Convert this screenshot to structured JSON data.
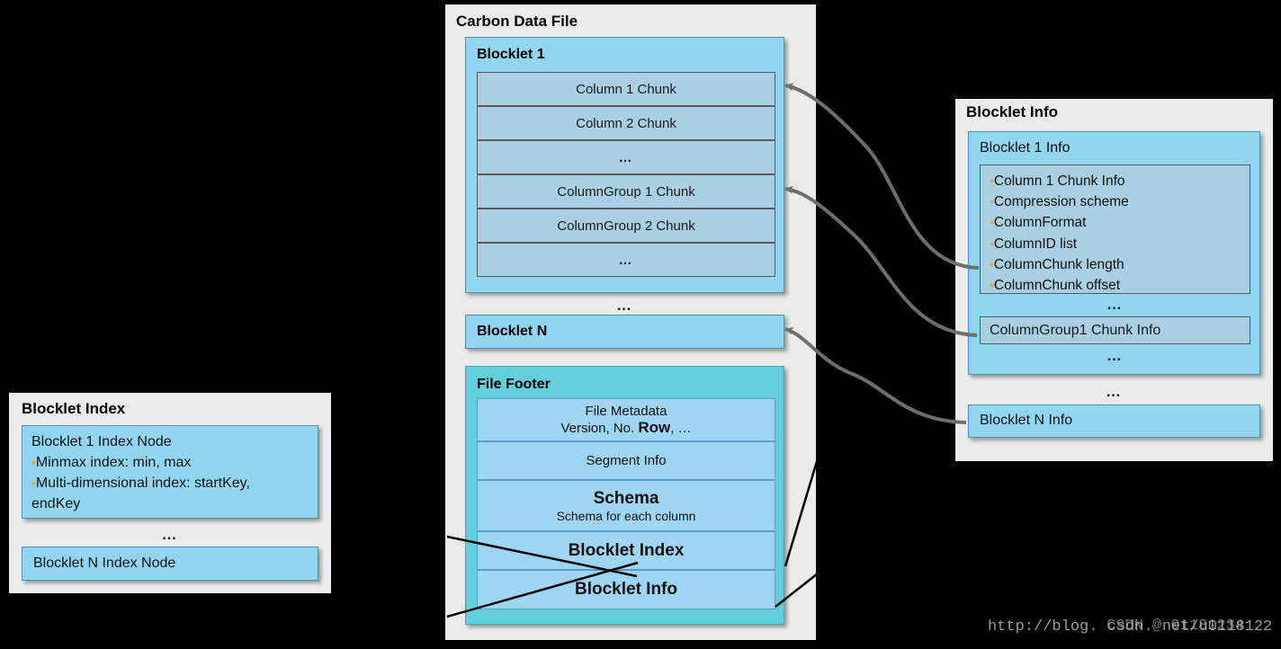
{
  "carbon_data_file": {
    "title": "Carbon Data File",
    "blocklet1": {
      "title": "Blocklet 1",
      "chunks": [
        "Column 1 Chunk",
        "Column 2 Chunk",
        "…",
        "ColumnGroup 1 Chunk",
        "ColumnGroup 2 Chunk",
        "…"
      ]
    },
    "ellipsis": "…",
    "blockletN": "Blocklet N",
    "file_footer": {
      "title": "File Footer",
      "rows": [
        {
          "line1": "File Metadata",
          "line2_pre": "Version, No. ",
          "line2_strong": "Row",
          "line2_post": ", …"
        },
        {
          "line1": "Segment Info"
        },
        {
          "line1": "Schema",
          "line2_pre": "Schema for each column"
        },
        {
          "line1": "Blocklet Index"
        },
        {
          "line1": "Blocklet Info"
        }
      ]
    }
  },
  "blocklet_info": {
    "title": "Blocklet Info",
    "blocklet1_info": {
      "title": "Blocklet 1 Info",
      "bullets": [
        "Column 1 Chunk Info",
        "Compression scheme",
        "ColumnFormat",
        "ColumnID list",
        "ColumnChunk length",
        "ColumnChunk offset"
      ],
      "ellipsis_after_bullets": "…",
      "columngroup_chunk_info": "ColumnGroup1 Chunk Info",
      "ellipsis_after_group": "…"
    },
    "ellipsis": "…",
    "blockletN_info": "Blocklet N Info"
  },
  "blocklet_index": {
    "title": "Blocklet Index",
    "node1": {
      "line1": "Blocklet 1 Index Node",
      "line2": "Minmax index: min, max",
      "line3": "Multi-dimensional index: startKey,",
      "line4": "endKey"
    },
    "ellipsis": "…",
    "nodeN": "Blocklet N Index Node"
  },
  "icons": {
    "bullet": "•",
    "arrow": "arrow-left-icon"
  },
  "watermark": {
    "line_a": "http://blog. csdn. net/u0118122",
    "line_b": "CSDN @ 01181234"
  },
  "colors": {
    "panel_bg": "#ebebeb",
    "blue": "#92d5f0",
    "chunk_blue": "#a9cfe2",
    "teal": "#64cfdc",
    "footer_row": "#9ed5f2",
    "bullet_orange": "#e8a33d",
    "arrow_gray": "#6e6e6e",
    "background": "#000000"
  }
}
